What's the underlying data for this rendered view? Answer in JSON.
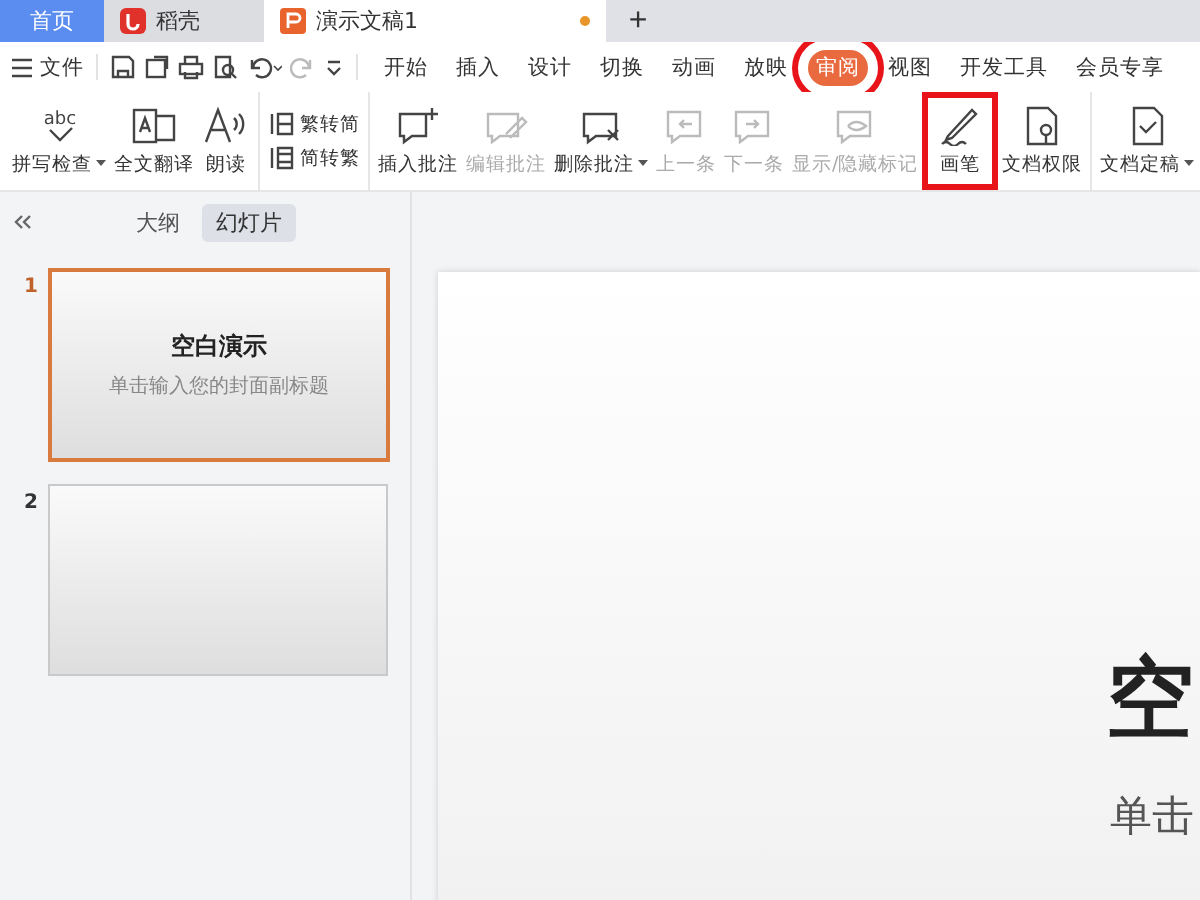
{
  "doc_tabs": [
    {
      "label": "首页",
      "kind": "home",
      "selected": false
    },
    {
      "label": "稻壳",
      "kind": "docer",
      "selected": false
    },
    {
      "label": "演示文稿1",
      "kind": "ppt",
      "selected": true,
      "unsaved": true
    }
  ],
  "new_tab": "+",
  "menu": {
    "file": "文件",
    "tabs": [
      {
        "label": "开始",
        "selected": false,
        "highlighted": false
      },
      {
        "label": "插入",
        "selected": false,
        "highlighted": false
      },
      {
        "label": "设计",
        "selected": false,
        "highlighted": false
      },
      {
        "label": "切换",
        "selected": false,
        "highlighted": false
      },
      {
        "label": "动画",
        "selected": false,
        "highlighted": false
      },
      {
        "label": "放映",
        "selected": false,
        "highlighted": false
      },
      {
        "label": "审阅",
        "selected": true,
        "highlighted": true
      },
      {
        "label": "视图",
        "selected": false,
        "highlighted": false
      },
      {
        "label": "开发工具",
        "selected": false,
        "highlighted": false
      },
      {
        "label": "会员专享",
        "selected": false,
        "highlighted": false
      }
    ]
  },
  "ribbon": [
    {
      "buttons": [
        {
          "kind": "big",
          "label": "拼写检查",
          "icon_text": "abc",
          "dropdown": true,
          "disabled": false,
          "highlighted": false
        },
        {
          "kind": "big",
          "label": "全文翻译",
          "dropdown": false,
          "disabled": false,
          "highlighted": false
        },
        {
          "kind": "big",
          "label": "朗读",
          "dropdown": false,
          "disabled": false,
          "highlighted": false
        }
      ]
    },
    {
      "buttons": [
        {
          "kind": "small",
          "label": "繁转简",
          "dropdown": false,
          "disabled": false,
          "highlighted": false
        },
        {
          "kind": "small",
          "label": "简转繁",
          "dropdown": false,
          "disabled": false,
          "highlighted": false
        }
      ]
    },
    {
      "buttons": [
        {
          "kind": "big",
          "label": "插入批注",
          "dropdown": false,
          "disabled": false,
          "highlighted": false
        },
        {
          "kind": "big",
          "label": "编辑批注",
          "dropdown": false,
          "disabled": true,
          "highlighted": false
        },
        {
          "kind": "big",
          "label": "删除批注",
          "dropdown": true,
          "disabled": false,
          "highlighted": false
        },
        {
          "kind": "big",
          "label": "上一条",
          "dropdown": false,
          "disabled": true,
          "highlighted": false
        },
        {
          "kind": "big",
          "label": "下一条",
          "dropdown": false,
          "disabled": true,
          "highlighted": false
        },
        {
          "kind": "big",
          "label": "显示/隐藏标记",
          "dropdown": false,
          "disabled": true,
          "highlighted": false
        },
        {
          "kind": "big",
          "label": "画笔",
          "dropdown": false,
          "disabled": false,
          "highlighted": true
        },
        {
          "kind": "big",
          "label": "文档权限",
          "dropdown": false,
          "disabled": false,
          "highlighted": false
        }
      ]
    },
    {
      "buttons": [
        {
          "kind": "big",
          "label": "文档定稿",
          "dropdown": true,
          "disabled": false,
          "highlighted": false
        }
      ]
    }
  ],
  "panel": {
    "tabs": [
      {
        "label": "大纲",
        "selected": false
      },
      {
        "label": "幻灯片",
        "selected": true
      }
    ],
    "slides": [
      {
        "number": "1",
        "selected": true,
        "title": "空白演示",
        "subtitle": "单击输入您的封面副标题"
      },
      {
        "number": "2",
        "selected": false
      }
    ]
  },
  "slide": {
    "title": "空",
    "subtitle": "单击"
  }
}
